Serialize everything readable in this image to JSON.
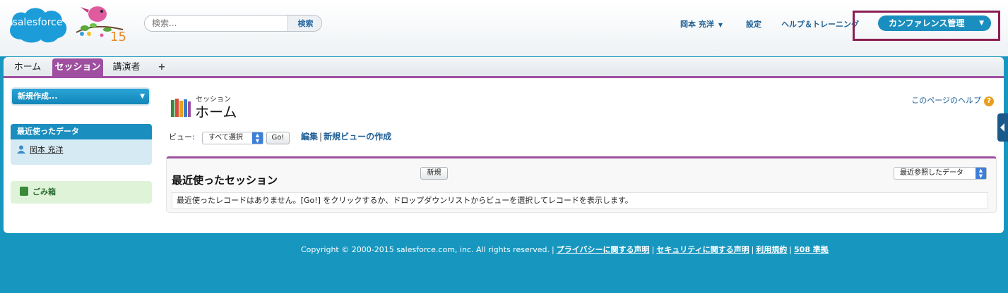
{
  "header": {
    "logo_text": "salesforce",
    "mascot_number": "15",
    "search": {
      "placeholder": "検索...",
      "button": "検索"
    },
    "user_menu": "岡本 充洋",
    "setup": "設定",
    "help_training": "ヘルプ＆トレーニング",
    "app_switcher": "カンファレンス管理"
  },
  "tabs": [
    {
      "label": "ホーム"
    },
    {
      "label": "セッション"
    },
    {
      "label": "講演者"
    },
    {
      "label": "+"
    }
  ],
  "sidebar": {
    "new_button": "新規作成...",
    "recent_title": "最近使ったデータ",
    "recent_items": [
      {
        "label": "岡本 充洋"
      }
    ],
    "trash": "ごみ箱"
  },
  "main": {
    "object_label": "セッション",
    "page_title": "ホーム",
    "help_link": "このページのヘルプ",
    "help_icon_char": "?",
    "view_label": "ビュー:",
    "view_select": "すべて選択",
    "go_button": "Go!",
    "edit_link": "編集",
    "separator": "|",
    "new_view_link": "新規ビューの作成",
    "recent_section": {
      "title": "最近使ったセッション",
      "new_button": "新規",
      "sort_select": "最近参照したデータ",
      "empty_message": "最近使ったレコードはありません。[Go!] をクリックするか、ドロップダウンリストからビューを選択してレコードを表示します。"
    }
  },
  "footer": {
    "copyright": "Copyright © 2000-2015 salesforce.com, inc. All rights reserved.",
    "separator": "|",
    "links": [
      {
        "label": "プライバシーに関する声明"
      },
      {
        "label": "セキュリティに関する声明"
      },
      {
        "label": "利用規約"
      },
      {
        "label": "508 準拠"
      }
    ]
  },
  "colors": {
    "brand_blue": "#1797c0",
    "tab_accent": "#9e4fa0",
    "highlight_box": "#8a1e52"
  },
  "icons": {
    "app_logo": "salesforce-cloud-icon",
    "mascot": "bird-mascot-icon",
    "user_caret": "caret-down-icon",
    "recent_item": "person-icon",
    "trash": "trash-icon",
    "page": "books-icon",
    "help": "question-icon",
    "side_toggle": "chevron-left-icon"
  }
}
